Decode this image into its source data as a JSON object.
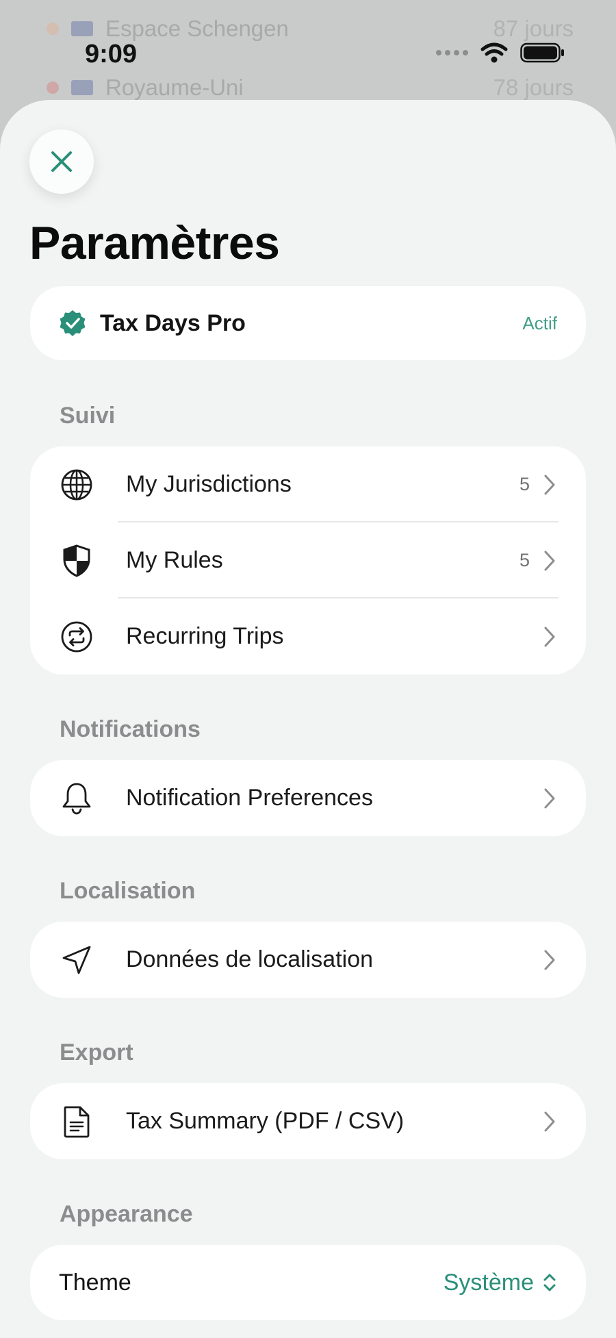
{
  "status_bar": {
    "time": "9:09"
  },
  "background_list": [
    {
      "name": "Espace Schengen",
      "days": "87 jours",
      "dot_color": "#f0a070"
    },
    {
      "name": "Royaume-Uni",
      "days": "78 jours",
      "dot_color": "#e05050"
    }
  ],
  "sheet": {
    "title": "Paramètres",
    "pro": {
      "title": "Tax Days Pro",
      "status": "Actif"
    },
    "sections": {
      "suivi": {
        "label": "Suivi",
        "items": [
          {
            "label": "My Jurisdictions",
            "count": "5",
            "icon": "globe-icon"
          },
          {
            "label": "My Rules",
            "count": "5",
            "icon": "shield-icon"
          },
          {
            "label": "Recurring Trips",
            "count": "",
            "icon": "repeat-icon"
          }
        ]
      },
      "notifications": {
        "label": "Notifications",
        "items": [
          {
            "label": "Notification Preferences",
            "icon": "bell-icon"
          }
        ]
      },
      "localisation": {
        "label": "Localisation",
        "items": [
          {
            "label": "Données de localisation",
            "icon": "location-arrow-icon"
          }
        ]
      },
      "export": {
        "label": "Export",
        "items": [
          {
            "label": "Tax Summary (PDF / CSV)",
            "icon": "document-icon"
          }
        ]
      },
      "appearance": {
        "label": "Appearance",
        "theme_label": "Theme",
        "theme_value": "Système"
      }
    }
  },
  "colors": {
    "accent": "#2a8f79",
    "background": "#f2f4f4",
    "card": "#ffffff"
  }
}
